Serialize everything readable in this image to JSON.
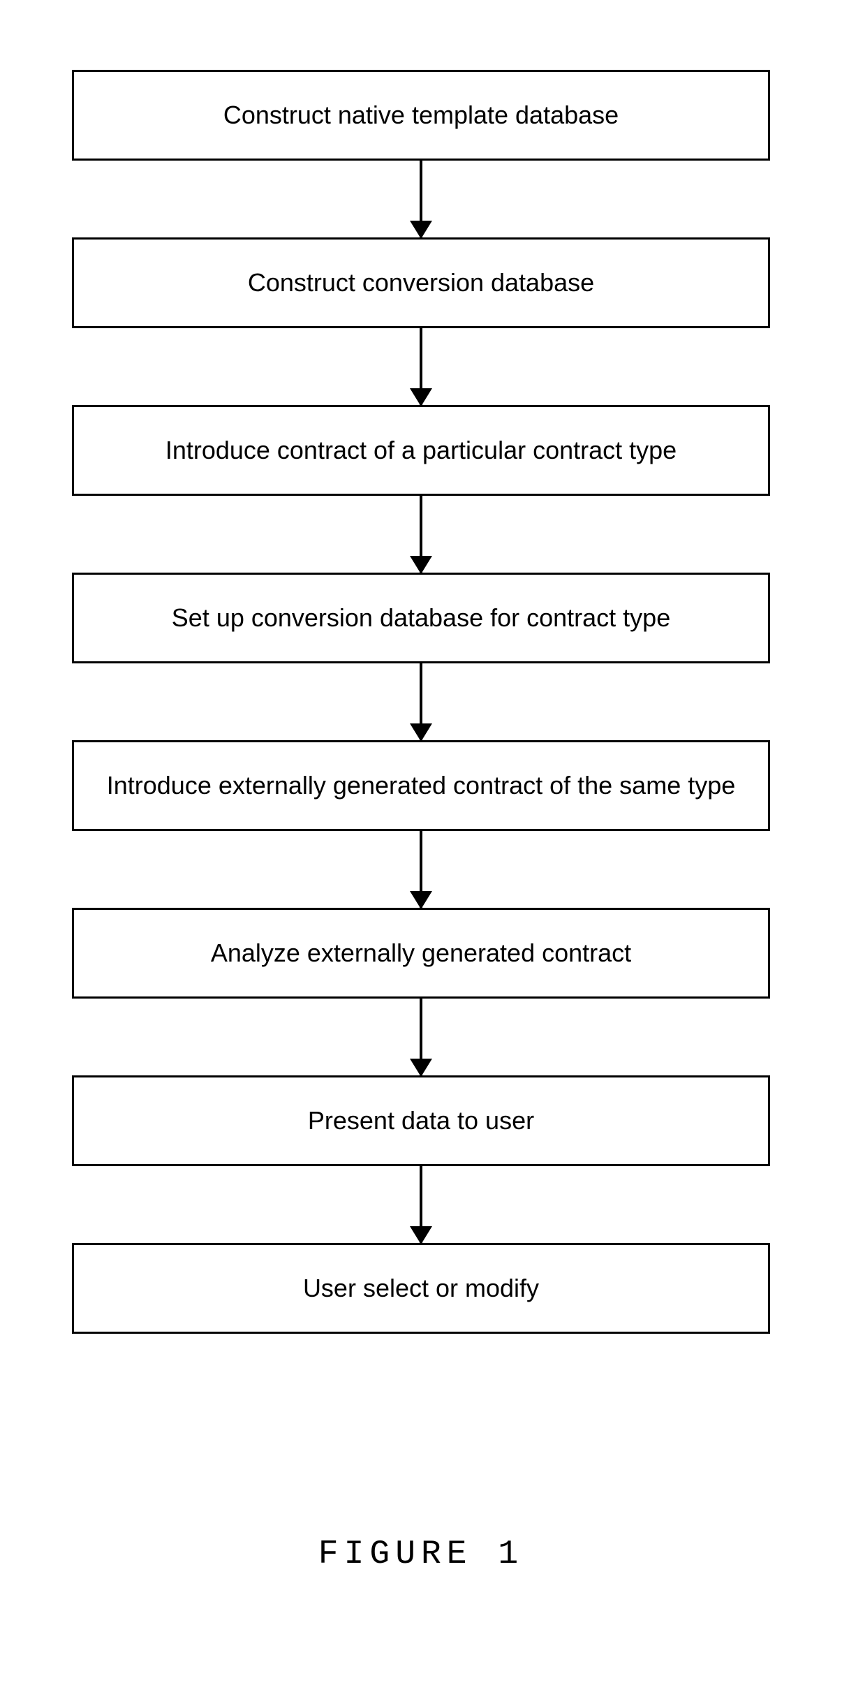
{
  "flowchart": {
    "steps": [
      {
        "label": "Construct native template database"
      },
      {
        "label": "Construct conversion database"
      },
      {
        "label": "Introduce contract of a particular contract type"
      },
      {
        "label": "Set up conversion database for contract type"
      },
      {
        "label": "Introduce externally generated contract of the same type"
      },
      {
        "label": "Analyze externally generated contract"
      },
      {
        "label": "Present data to user"
      },
      {
        "label": "User select or modify"
      }
    ]
  },
  "figure_label": "FIGURE 1"
}
